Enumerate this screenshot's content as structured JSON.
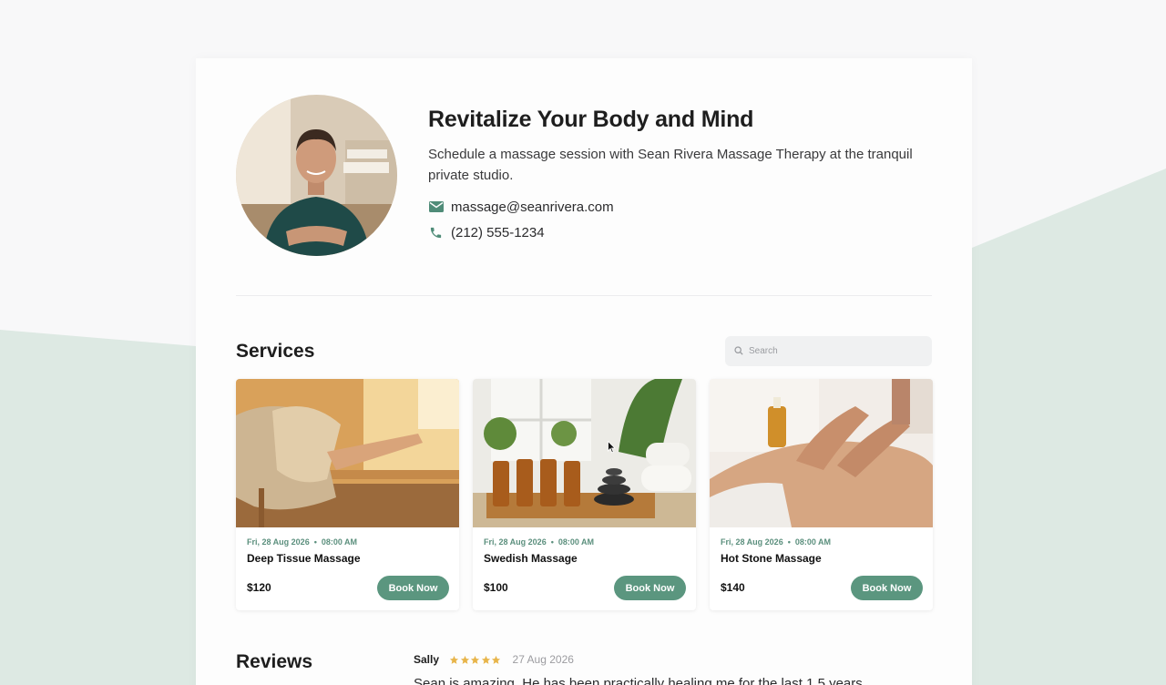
{
  "hero": {
    "title": "Revitalize Your Body and Mind",
    "subtitle": "Schedule a massage session with Sean Rivera Massage Therapy at the tranquil private studio.",
    "email": "massage@seanrivera.com",
    "phone": "(212) 555-1234",
    "email_icon": "mail-icon",
    "phone_icon": "phone-icon",
    "avatar": "therapist-portrait"
  },
  "services": {
    "title": "Services",
    "search_placeholder": "Search",
    "items": [
      {
        "date": "Fri, 28 Aug 2026",
        "time": "08:00 AM",
        "name": "Deep Tissue Massage",
        "price": "$120",
        "button": "Book Now",
        "image": "relaxing-legs-blanket-photo"
      },
      {
        "date": "Fri, 28 Aug 2026",
        "time": "08:00 AM",
        "name": "Swedish Massage",
        "price": "$100",
        "button": "Book Now",
        "image": "oils-stones-towels-photo"
      },
      {
        "date": "Fri, 28 Aug 2026",
        "time": "08:00 AM",
        "name": "Hot Stone Massage",
        "price": "$140",
        "button": "Book Now",
        "image": "back-massage-photo"
      }
    ]
  },
  "reviews": {
    "title": "Reviews",
    "items": [
      {
        "name": "Sally",
        "rating": 5,
        "date": "27 Aug 2026",
        "text": "Sean is amazing. He has been practically healing me for the last 1.5 years"
      }
    ]
  },
  "colors": {
    "accent": "#5b967f",
    "background_shape": "#dde9e3",
    "star": "#e8b54a"
  }
}
